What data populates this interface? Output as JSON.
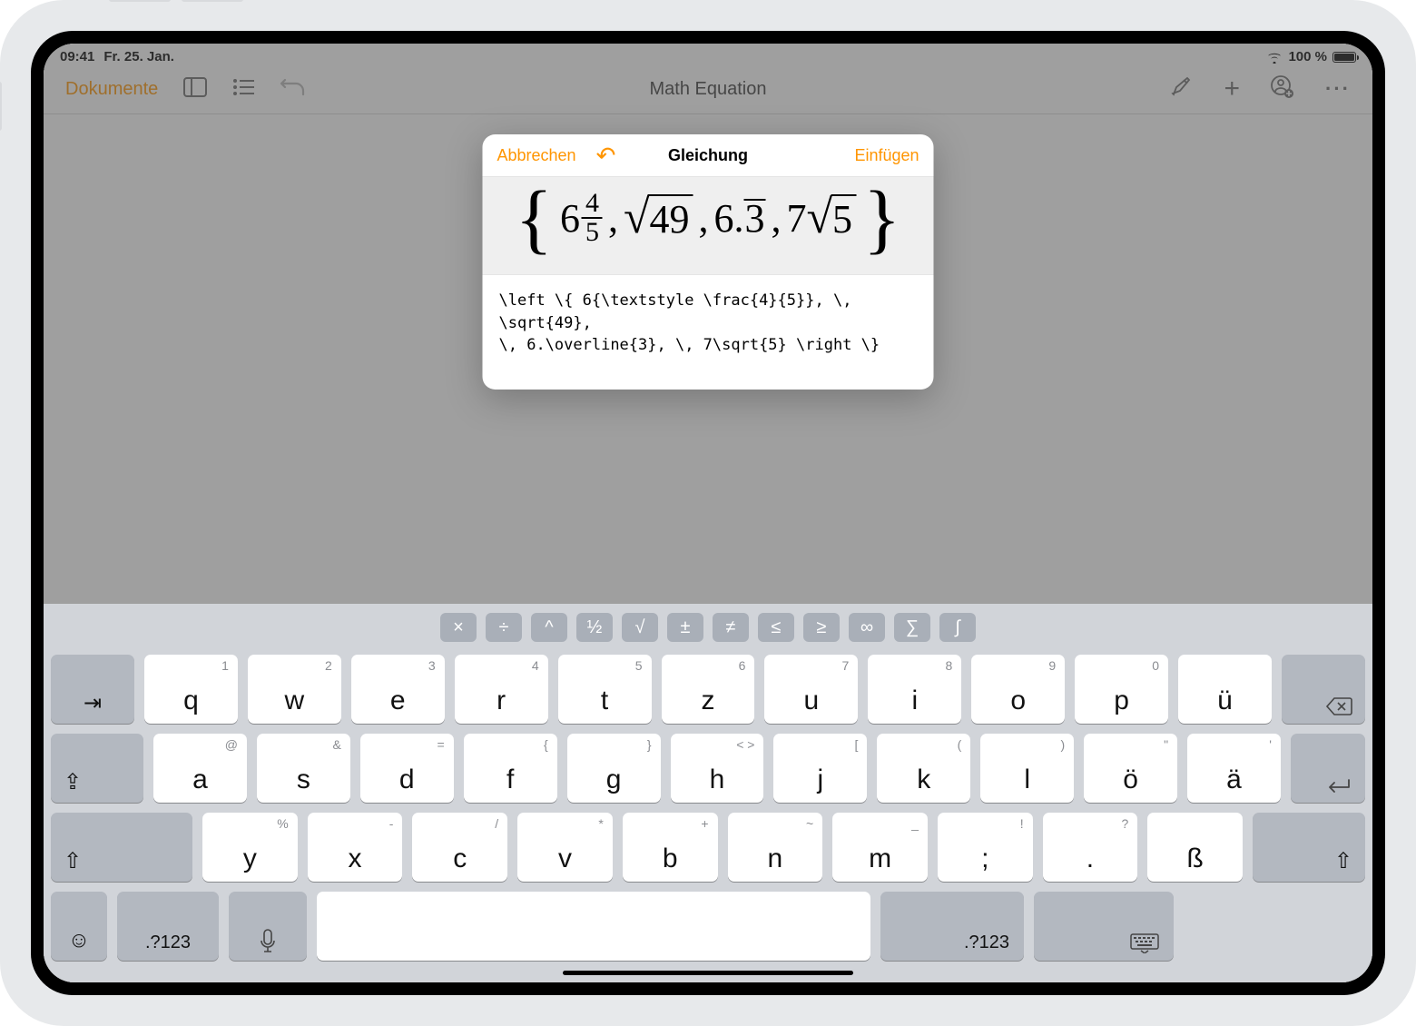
{
  "status": {
    "time": "09:41",
    "date": "Fr. 25. Jan.",
    "battery_pct": "100 %"
  },
  "toolbar": {
    "documents": "Dokumente",
    "title": "Math Equation"
  },
  "popover": {
    "cancel": "Abbrechen",
    "title": "Gleichung",
    "insert": "Einfügen",
    "preview": {
      "six": "6",
      "frac_num": "4",
      "frac_den": "5",
      "sqrt49": "49",
      "dec_int": "6",
      "dec_dot": ".",
      "dec_rep": "3",
      "seven": "7",
      "sqrt5": "5"
    },
    "source": "\\left \\{ 6{\\textstyle \\frac{4}{5}}, \\,\n\\sqrt{49},\n\\, 6.\\overline{3}, \\, 7\\sqrt{5} \\right \\}"
  },
  "keyboard": {
    "sugg": [
      "×",
      "÷",
      "^",
      "½",
      "√",
      "±",
      "≠",
      "≤",
      "≥",
      "∞",
      "∑",
      "∫"
    ],
    "row1": [
      {
        "main": "q",
        "alt": "1"
      },
      {
        "main": "w",
        "alt": "2"
      },
      {
        "main": "e",
        "alt": "3"
      },
      {
        "main": "r",
        "alt": "4"
      },
      {
        "main": "t",
        "alt": "5"
      },
      {
        "main": "z",
        "alt": "6"
      },
      {
        "main": "u",
        "alt": "7"
      },
      {
        "main": "i",
        "alt": "8"
      },
      {
        "main": "o",
        "alt": "9"
      },
      {
        "main": "p",
        "alt": "0"
      },
      {
        "main": "ü",
        "alt": ""
      }
    ],
    "row2": [
      {
        "main": "a",
        "alt": "@"
      },
      {
        "main": "s",
        "alt": "&"
      },
      {
        "main": "d",
        "alt": "="
      },
      {
        "main": "f",
        "alt": "{"
      },
      {
        "main": "g",
        "alt": "}"
      },
      {
        "main": "h",
        "alt": "<   >"
      },
      {
        "main": "j",
        "alt": "["
      },
      {
        "main": "k",
        "alt": "("
      },
      {
        "main": "l",
        "alt": ")"
      },
      {
        "main": "ö",
        "alt": "\""
      },
      {
        "main": "ä",
        "alt": "'"
      }
    ],
    "row3": [
      {
        "main": "y",
        "alt": "%"
      },
      {
        "main": "x",
        "alt": "-"
      },
      {
        "main": "c",
        "alt": "/"
      },
      {
        "main": "v",
        "alt": "*"
      },
      {
        "main": "b",
        "alt": "+"
      },
      {
        "main": "n",
        "alt": "~"
      },
      {
        "main": "m",
        "alt": "_"
      },
      {
        "main": ";",
        "alt": "!"
      },
      {
        "main": ".",
        "alt": "?"
      },
      {
        "main": "ß",
        "alt": ""
      }
    ],
    "mode_label": ".?123"
  }
}
